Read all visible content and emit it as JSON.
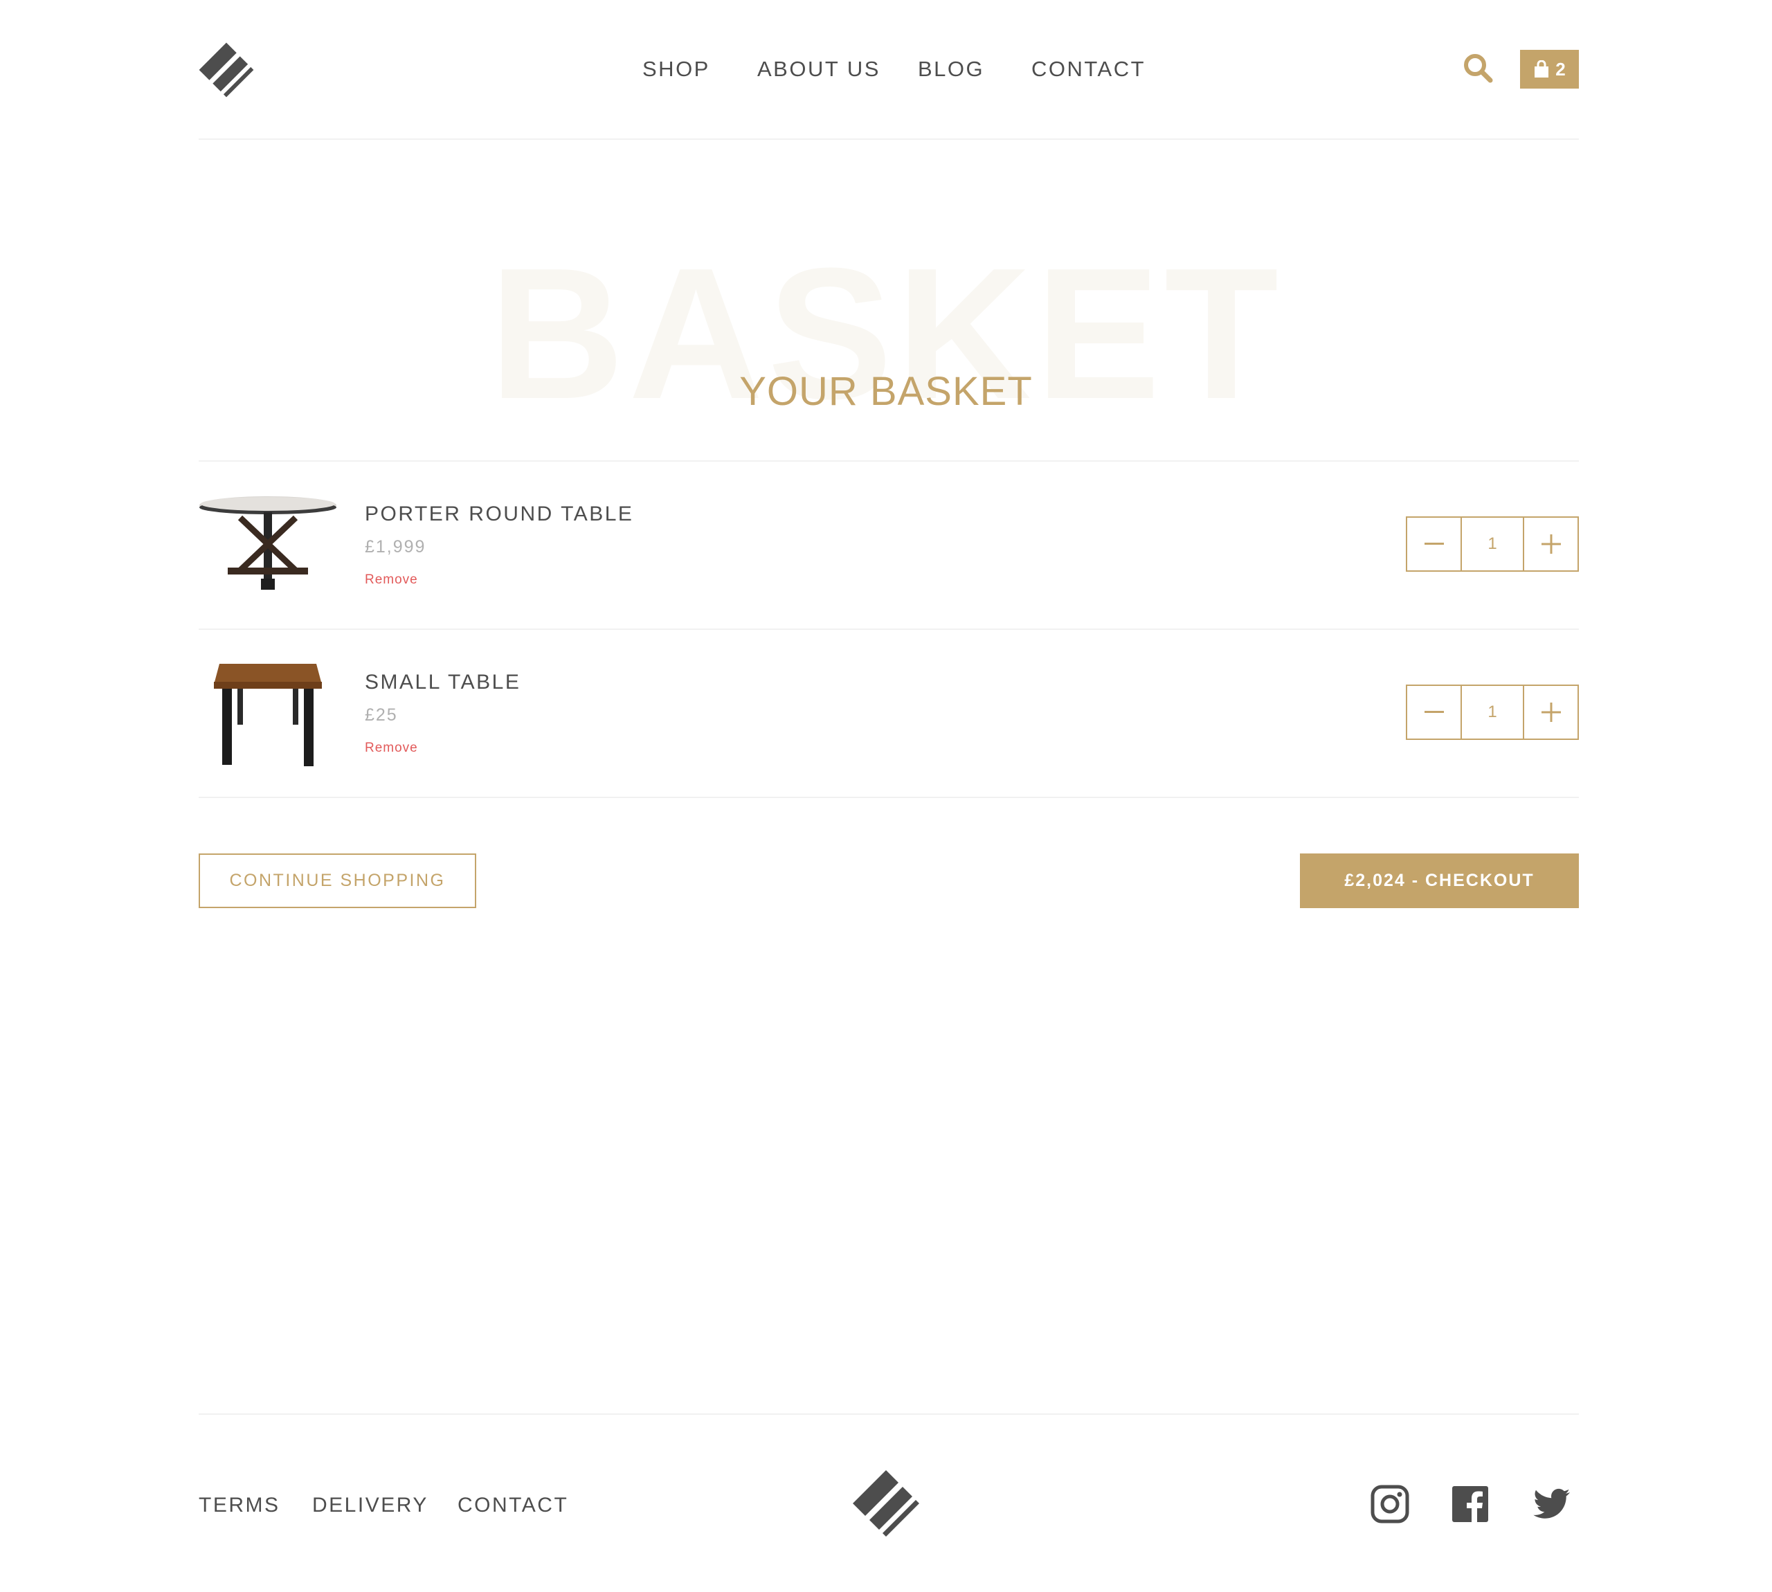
{
  "header": {
    "logo_icon": "diagonal-stripes-logo",
    "nav": [
      "SHOP",
      "ABOUT US",
      "BLOG",
      "CONTACT"
    ],
    "search_icon": "search-icon",
    "cart_icon": "shopping-bag-icon",
    "cart_count": "2"
  },
  "hero": {
    "background_text": "BASKET",
    "title": "YOUR BASKET"
  },
  "basket": {
    "items": [
      {
        "name": "PORTER ROUND TABLE",
        "price": "£1,999",
        "remove_label": "Remove",
        "quantity": "1",
        "image_icon": "round-table-image"
      },
      {
        "name": "SMALL TABLE",
        "price": "£25",
        "remove_label": "Remove",
        "quantity": "1",
        "image_icon": "small-table-image"
      }
    ],
    "decrement_icon": "minus-icon",
    "increment_icon": "plus-icon"
  },
  "actions": {
    "continue_label": "CONTINUE SHOPPING",
    "checkout_label": "£2,024 - CHECKOUT"
  },
  "footer": {
    "links": [
      "TERMS",
      "DELIVERY",
      "CONTACT"
    ],
    "social_icons": [
      "instagram-icon",
      "facebook-icon",
      "twitter-icon"
    ]
  },
  "colors": {
    "accent": "#c4a46a",
    "text": "#4d4d4d",
    "muted": "#b0b0b0",
    "remove": "#e25a5a",
    "divider": "#f1f1f1"
  }
}
